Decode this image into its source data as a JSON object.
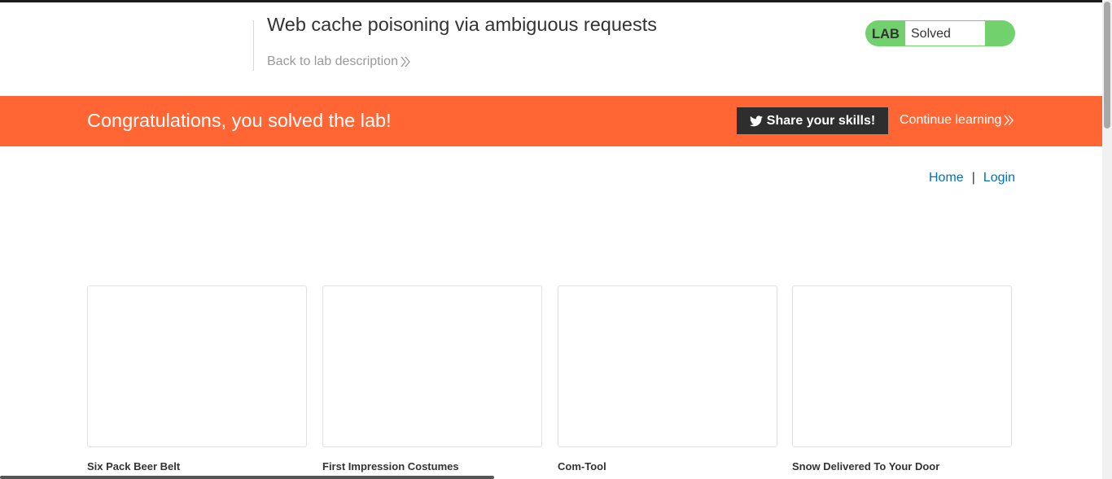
{
  "header": {
    "title": "Web cache poisoning via ambiguous requests",
    "back_link": "Back to lab description",
    "status": {
      "badge": "LAB",
      "state": "Solved"
    }
  },
  "banner": {
    "message": "Congratulations, you solved the lab!",
    "share_label": "Share your skills!",
    "continue_label": "Continue learning"
  },
  "nav": {
    "home": "Home",
    "separator": "|",
    "login": "Login"
  },
  "products": [
    {
      "name": "Six Pack Beer Belt"
    },
    {
      "name": "First Impression Costumes"
    },
    {
      "name": "Com-Tool"
    },
    {
      "name": "Snow Delivered To Your Door"
    }
  ],
  "colors": {
    "banner": "#ff6633",
    "status": "#70d16d",
    "link": "#0071bc",
    "share_button": "#2e2e2e"
  },
  "icons": [
    "chevron-double-right-icon",
    "twitter-icon"
  ]
}
